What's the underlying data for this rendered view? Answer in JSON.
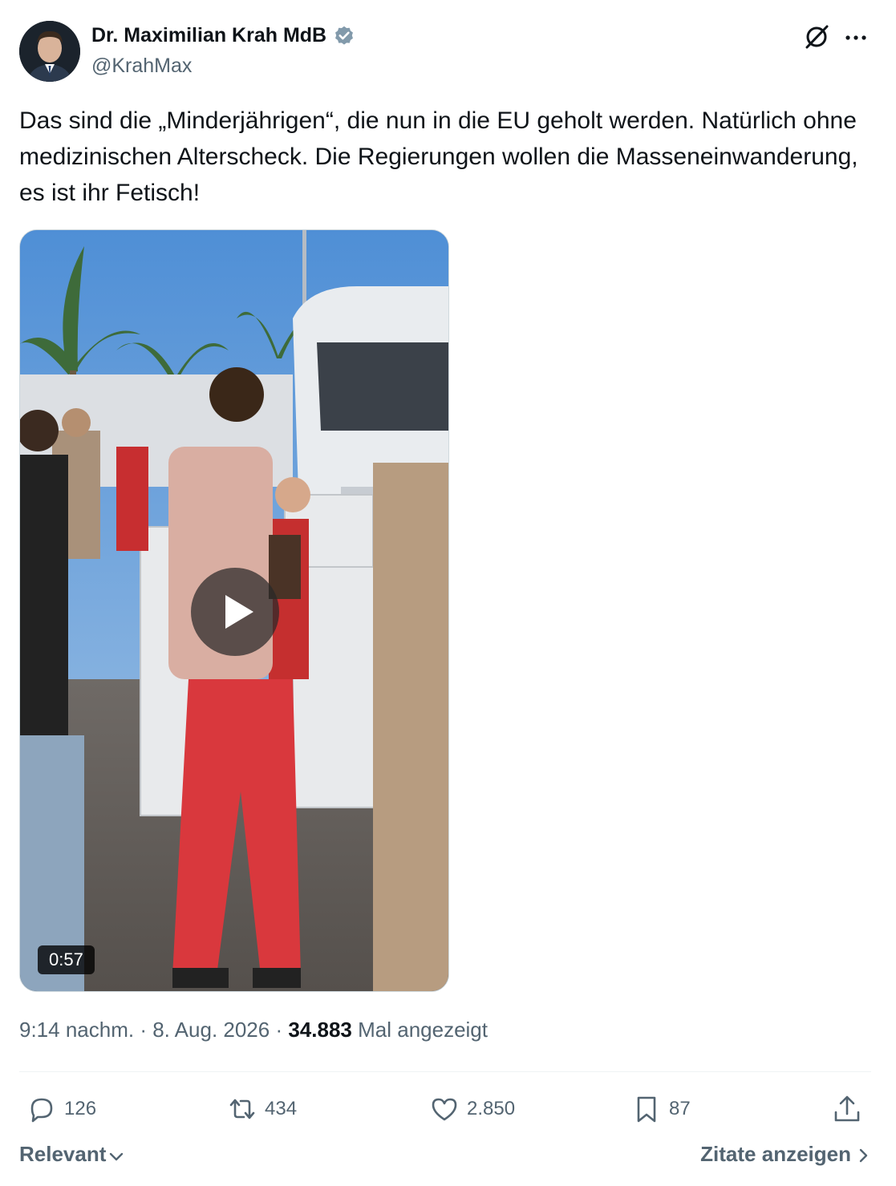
{
  "author": {
    "name": "Dr. Maximilian Krah MdB",
    "handle": "@KrahMax",
    "verified_icon": "verified-badge-icon",
    "verified_color": "#829aab"
  },
  "header": {
    "grok_icon": "grok-icon",
    "more_icon": "more-options-icon"
  },
  "tweet": {
    "text": "Das sind die „Minderjährigen“, die nun in die EU geholt werden. Natürlich ohne medizinischen Alterscheck. Die Regierungen wollen die Masseneinwanderung, es ist ihr Fetisch!"
  },
  "media": {
    "type": "video",
    "duration": "0:57",
    "play_icon": "play-icon"
  },
  "meta": {
    "time": "9:14 nachm.",
    "separator": " · ",
    "date": "8. Aug. 2026",
    "views_count": "34.883",
    "views_label": "Mal angezeigt"
  },
  "actions": {
    "replies": "126",
    "reposts": "434",
    "likes": "2.850",
    "bookmarks": "87"
  },
  "footer": {
    "sort_label": "Relevant",
    "quotes_label": "Zitate anzeigen"
  },
  "colors": {
    "text_primary": "#0f1419",
    "text_secondary": "#536471",
    "divider": "#eff3f4"
  }
}
